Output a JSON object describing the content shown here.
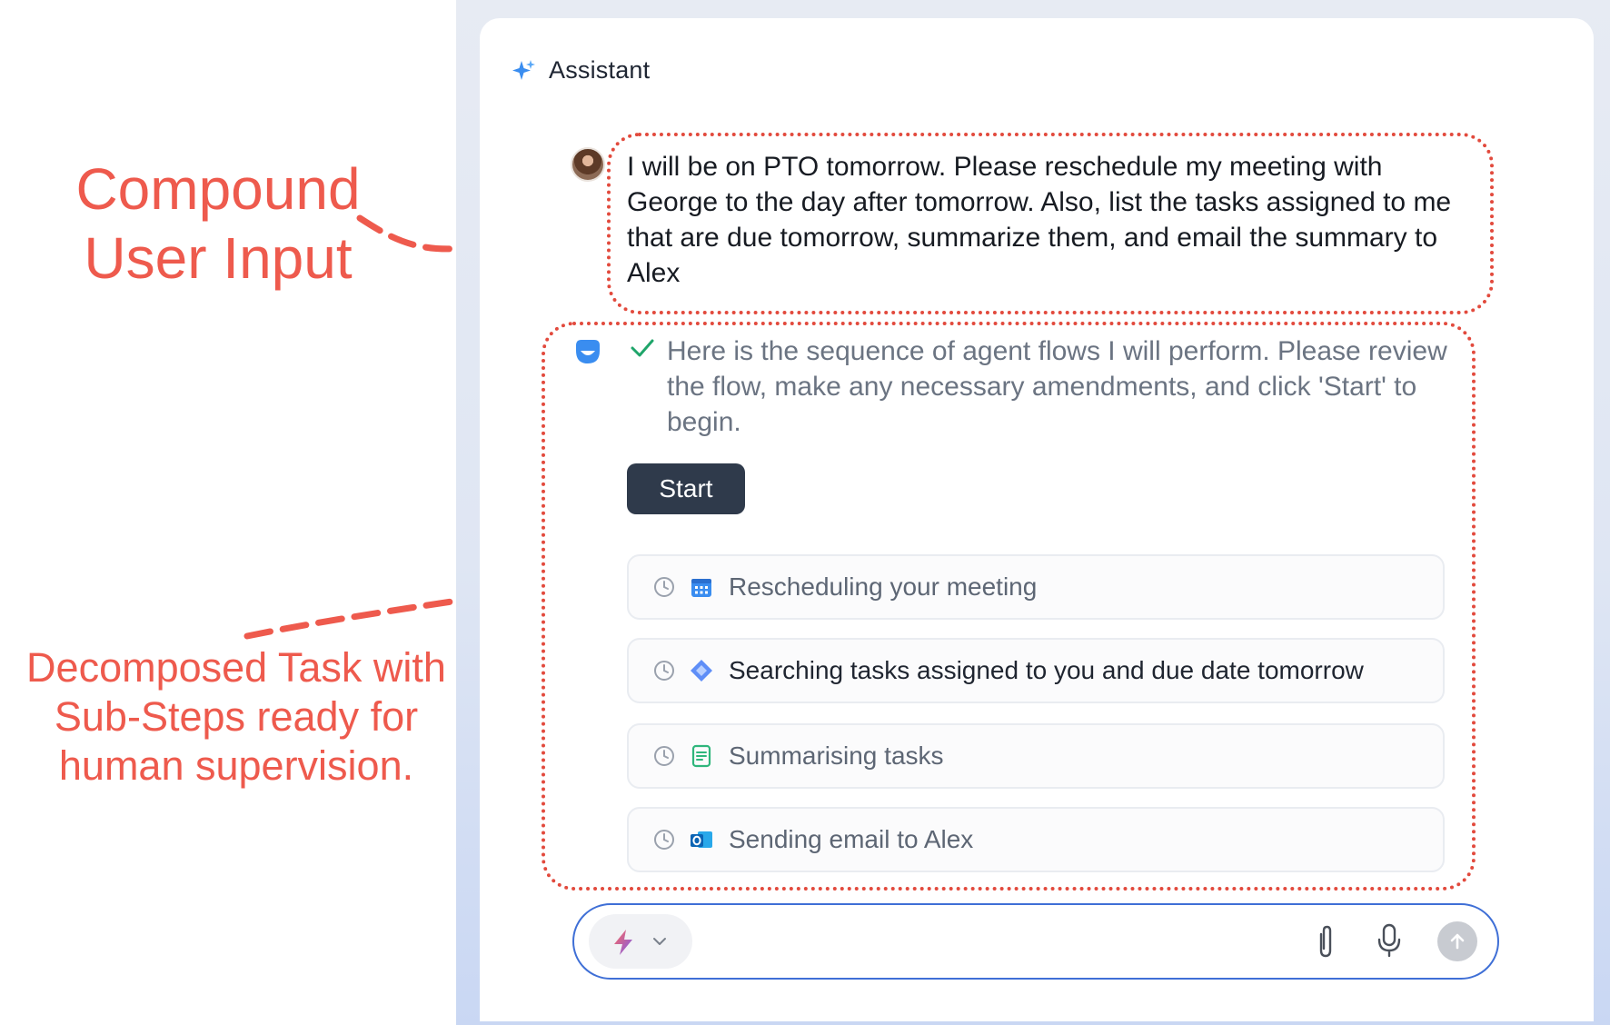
{
  "annotations": {
    "compound_input": "Compound User Input",
    "decomposed_task": "Decomposed Task with Sub-Steps ready for human supervision."
  },
  "header": {
    "title": "Assistant",
    "icon": "sparkle-icon"
  },
  "conversation": {
    "user_message": "I will be on PTO tomorrow. Please reschedule my meeting with George to the day after tomorrow. Also, list the tasks assigned to me that are due tomorrow, summarize them, and email the summary to Alex",
    "agent_message": "Here is the sequence of agent flows I will perform. Please review the flow, make any necessary amendments, and click 'Start' to begin.",
    "start_label": "Start"
  },
  "steps": [
    {
      "label": "Rescheduling your meeting",
      "icon": "calendar-icon",
      "status": "pending"
    },
    {
      "label": "Searching tasks assigned to you and due date tomorrow",
      "icon": "diamond-task-icon",
      "status": "pending"
    },
    {
      "label": "Summarising tasks",
      "icon": "document-icon",
      "status": "pending"
    },
    {
      "label": "Sending email to Alex",
      "icon": "outlook-icon",
      "status": "pending"
    }
  ],
  "input_bar": {
    "mode_icon": "lightning-icon",
    "icons": [
      "paperclip-icon",
      "microphone-icon",
      "send-icon"
    ]
  },
  "colors": {
    "annotation": "#ee5a4d",
    "start_button": "#2f3a4b",
    "input_border": "#3f6fd6",
    "check": "#1fa56a"
  }
}
